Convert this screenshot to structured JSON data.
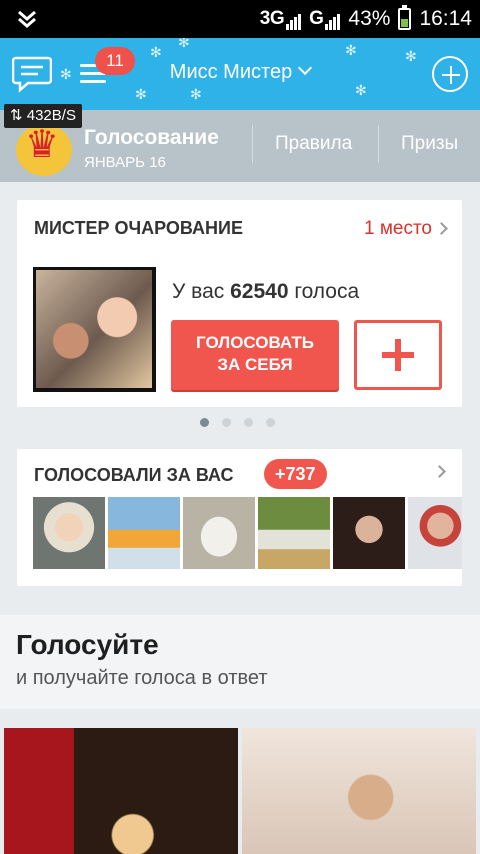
{
  "status_bar": {
    "network_1": "3G",
    "network_2": "G",
    "battery": "43%",
    "time": "16:14"
  },
  "app_bar": {
    "title": "Мисс Мистер",
    "notifications": "11"
  },
  "speed_indicator": "432B/S",
  "contest_header": {
    "title": "Голосование",
    "subtitle": "ЯНВАРЬ 16",
    "tabs": [
      "Правила",
      "Призы"
    ]
  },
  "nomination_card": {
    "title": "МИСТЕР ОЧАРОВАНИЕ",
    "place": "1 место",
    "votes_prefix": "У вас",
    "votes_count": "62540",
    "votes_suffix": "голоса",
    "vote_self_button_line1": "ГОЛОСОВАТЬ",
    "vote_self_button_line2": "ЗА СЕБЯ"
  },
  "voted_card": {
    "title": "ГОЛОСОВАЛИ ЗА ВАС",
    "count_badge": "+737"
  },
  "promo": {
    "title": "Голосуйте",
    "subtitle": "и получайте голоса в ответ"
  },
  "colors": {
    "accent_blue": "#2fb2e8",
    "accent_red": "#f0564e",
    "header_gray": "#b7c2c9"
  }
}
